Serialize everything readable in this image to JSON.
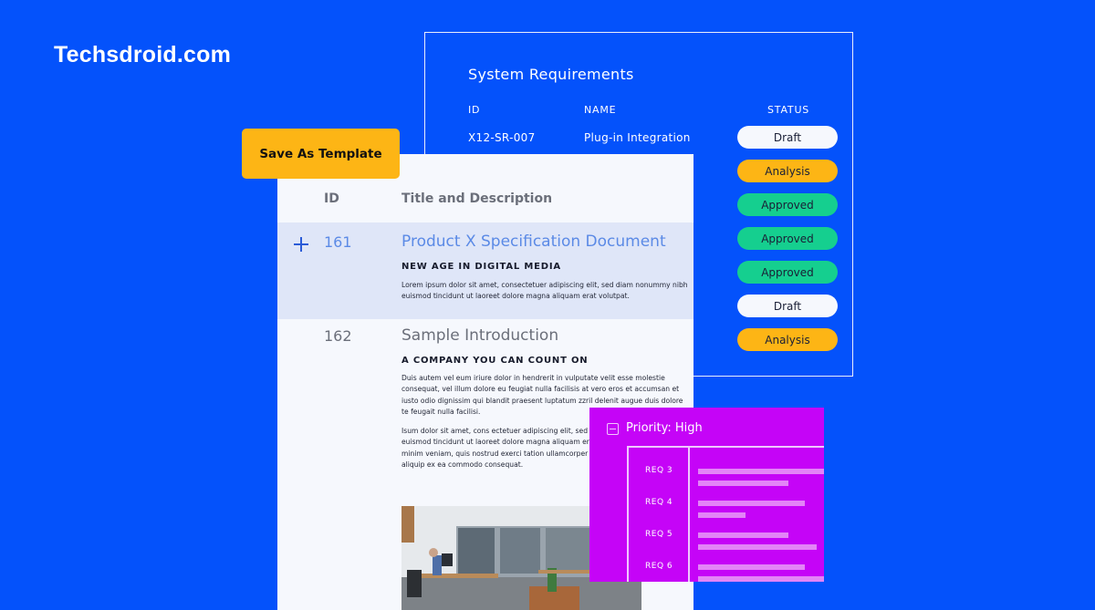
{
  "brand": "Techsdroid.com",
  "colors": {
    "background": "#0452fb",
    "accent_yellow": "#fdb515",
    "approved_green": "#15cf8f",
    "draft_white": "#f6f8fd",
    "priority_purple": "#c504f7",
    "link_blue": "#5b8ae6"
  },
  "system_requirements": {
    "title": "System Requirements",
    "headers": {
      "id": "ID",
      "name": "NAME",
      "status": "STATUS"
    },
    "first_row": {
      "id": "X12-SR-007",
      "name": "Plug-in Integration"
    },
    "statuses": [
      {
        "label": "Draft",
        "kind": "draft"
      },
      {
        "label": "Analysis",
        "kind": "analysis"
      },
      {
        "label": "Approved",
        "kind": "approved"
      },
      {
        "label": "Approved",
        "kind": "approved"
      },
      {
        "label": "Approved",
        "kind": "approved"
      },
      {
        "label": "Draft",
        "kind": "draft"
      },
      {
        "label": "Analysis",
        "kind": "analysis"
      }
    ]
  },
  "toolbar": {
    "save_template_label": "Save As Template"
  },
  "document": {
    "headers": {
      "id": "ID",
      "title": "Title and Description"
    },
    "rows": [
      {
        "id": "161",
        "title": "Product X Specification Document",
        "subtitle": "NEW AGE IN DIGITAL MEDIA",
        "paragraphs": [
          "Lorem ipsum dolor sit amet, consectetuer adipiscing elit, sed diam nonummy nibh euismod tincidunt ut laoreet dolore magna aliquam erat volutpat."
        ]
      },
      {
        "id": "162",
        "title": "Sample Introduction",
        "subtitle": "A COMPANY YOU CAN COUNT ON",
        "paragraphs": [
          "Duis autem vel eum iriure dolor in hendrerit in vulputate velit esse molestie consequat, vel illum dolore eu feugiat nulla facilisis at vero eros et accumsan et iusto odio dignissim qui blandit praesent luptatum zzril delenit augue duis dolore te feugait nulla facilisi.",
          "Isum dolor sit amet, cons ectetuer adipiscing elit, sed diam nonummy nibh euismod tincidunt ut laoreet dolore magna aliquam erat volutpat. Ut wisi enim ad minim veniam, quis nostrud exerci tation ullamcorper suscipit lobortis nisl ut aliquip ex ea commodo consequat."
        ],
        "image_alt": "office-photo"
      }
    ]
  },
  "priority": {
    "title": "Priority: High",
    "requirements": [
      {
        "label": "REQ 3",
        "bars": [
          1.0,
          0.72
        ]
      },
      {
        "label": "REQ 4",
        "bars": [
          0.85,
          0.38
        ]
      },
      {
        "label": "REQ 5",
        "bars": [
          0.72,
          0.94
        ]
      },
      {
        "label": "REQ 6",
        "bars": [
          0.85,
          1.0
        ]
      }
    ]
  }
}
